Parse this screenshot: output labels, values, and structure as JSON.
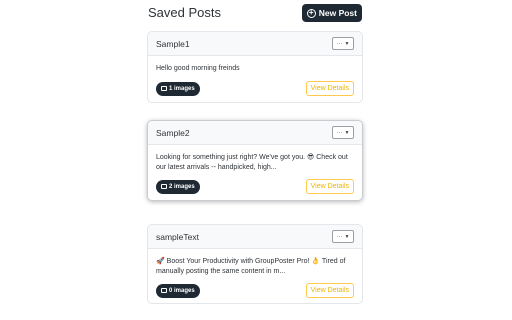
{
  "header": {
    "title": "Saved Posts",
    "new_post_label": "New Post"
  },
  "posts": [
    {
      "title": "Sample1",
      "text": "Hello good morning freinds",
      "images": "1 images",
      "view_label": "View Details"
    },
    {
      "title": "Sample2",
      "text": "Looking for something just right? We've got you. 😎 Check out our latest arrivals -- handpicked, high...",
      "images": "2 images",
      "view_label": "View Details"
    },
    {
      "title": "sampleText",
      "text": "🚀 Boost Your Productivity with GroupPoster Pro! 👌 Tired of manually posting the same content in m...",
      "images": "0 images",
      "view_label": "View Details"
    }
  ],
  "menu_glyph": "···",
  "icons": {
    "add": "plus-circle-icon",
    "images": "image-icon",
    "menu": "chevron-down-icon"
  },
  "colors": {
    "accent": "#1f2933",
    "view_button": "#f0b400"
  }
}
